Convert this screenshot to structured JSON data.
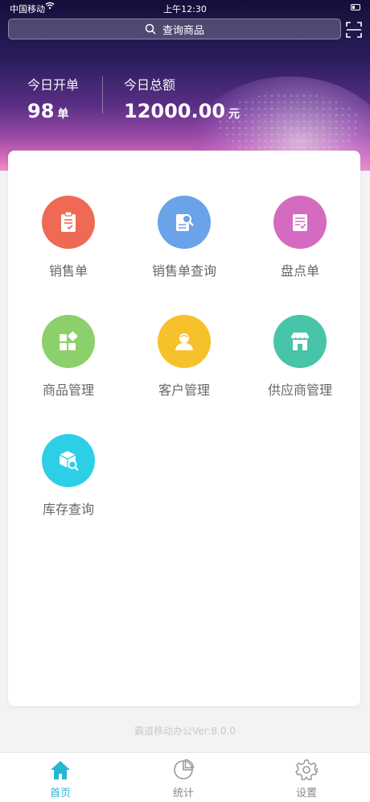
{
  "status_bar": {
    "carrier": "中国移动",
    "time": "上午12:30"
  },
  "search": {
    "placeholder": "查询商品"
  },
  "stats": {
    "orders_label": "今日开单",
    "orders_value": "98",
    "orders_unit": "单",
    "amount_label": "今日总额",
    "amount_value": "12000.00",
    "amount_unit": "元"
  },
  "modules": [
    {
      "label": "销售单",
      "icon": "clipboard-icon",
      "color": "#ee6a55"
    },
    {
      "label": "销售单查询",
      "icon": "document-search-icon",
      "color": "#6aa3e8"
    },
    {
      "label": "盘点单",
      "icon": "checklist-icon",
      "color": "#d46bc0"
    },
    {
      "label": "商品管理",
      "icon": "blocks-icon",
      "color": "#8bd06a"
    },
    {
      "label": "客户管理",
      "icon": "user-icon",
      "color": "#f7c12b"
    },
    {
      "label": "供应商管理",
      "icon": "store-icon",
      "color": "#48c4a8"
    },
    {
      "label": "库存查询",
      "icon": "box-search-icon",
      "color": "#2ccfe6"
    }
  ],
  "version": "霸道移动办公Ver:8.0.0",
  "tabs": [
    {
      "label": "首页",
      "icon": "home-icon",
      "active": true
    },
    {
      "label": "统计",
      "icon": "pie-chart-icon",
      "active": false
    },
    {
      "label": "设置",
      "icon": "gear-icon",
      "active": false
    }
  ],
  "colors": {
    "accent": "#29b6d6",
    "inactive": "#888888"
  }
}
